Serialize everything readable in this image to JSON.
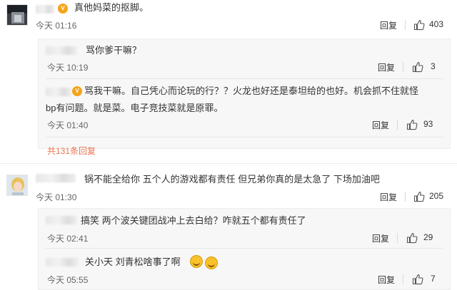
{
  "comments": {
    "c1": {
      "text": "真他妈菜的抠脚。",
      "time": "今天 01:16",
      "reply_label": "回复",
      "likes": "403"
    },
    "r1": {
      "text": "骂你爹干嘛？",
      "time": "今天 10:19",
      "reply_label": "回复",
      "likes": "3"
    },
    "r2": {
      "text_line1": "骂我干嘛。自己凭心而论玩的行？？火龙也好还是泰坦给的也好。机会抓不住就怪",
      "text_line2": "bp有问题。就是菜。电子竞技菜就是原罪。",
      "time": "今天 01:40",
      "reply_label": "回复",
      "likes": "93"
    },
    "total_replies": "共131条回复",
    "c2": {
      "text": "锅不能全给你 五个人的游戏都有责任 但兄弟你真的是太急了 下场加油吧",
      "time": "今天 01:30",
      "reply_label": "回复",
      "likes": "205"
    },
    "r3": {
      "text": "搞笑 两个波关键团战冲上去白给？咋就五个都有责任了",
      "time": "今天 02:41",
      "reply_label": "回复",
      "likes": "29"
    },
    "r4": {
      "text": "关小天 刘青松啥事了啊",
      "time": "今天 05:55",
      "reply_label": "回复",
      "likes": "7"
    }
  },
  "icons": {
    "like": "thumbs-up-icon",
    "vip": "vip-badge-icon",
    "emoji": "grin-emoji-icon"
  },
  "colors": {
    "accent_link": "#eb7350",
    "reply_bg": "#f7f7f7",
    "vip": "#f4a41b"
  }
}
